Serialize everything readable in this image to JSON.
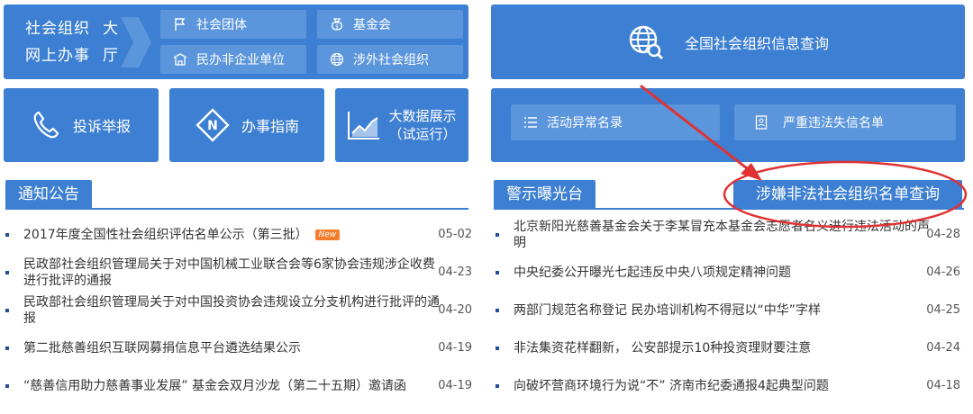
{
  "service_hall": {
    "title_line1": "社会组织",
    "title_line1_b": "大",
    "title_line2": "网上办事",
    "title_line2_b": "厅",
    "buttons": [
      {
        "label": "社会团体",
        "icon": "flag-icon"
      },
      {
        "label": "基金会",
        "icon": "money-bag-icon"
      },
      {
        "label": "民办非企业单位",
        "icon": "building-icon"
      },
      {
        "label": "涉外社会组织",
        "icon": "globe-icon"
      }
    ]
  },
  "info_query": {
    "label": "全国社会组织信息查询",
    "icon": "globe-search-icon"
  },
  "tiles": [
    {
      "label": "投诉举报",
      "icon": "phone-icon"
    },
    {
      "label": "办事指南",
      "icon": "compass-icon"
    },
    {
      "label_line1": "大数据展示",
      "label_line2": "（试运行）",
      "icon": "chart-icon"
    }
  ],
  "lists_box": {
    "abnormal": {
      "label": "活动异常名录",
      "icon": "list-icon"
    },
    "dishonest": {
      "label": "严重违法失信名单",
      "icon": "document-icon"
    }
  },
  "notice": {
    "tab_label": "通知公告",
    "items": [
      {
        "title": "2017年度全国性社会组织评估名单公示（第三批）",
        "badge": "New",
        "date": "05-02"
      },
      {
        "title": "民政部社会组织管理局关于对中国机械工业联合会等6家协会违规涉企收费进行批评的通报",
        "date": "04-23"
      },
      {
        "title": "民政部社会组织管理局关于对中国投资协会违规设立分支机构进行批评的通报",
        "date": "04-20"
      },
      {
        "title": "第二批慈善组织互联网募捐信息平台遴选结果公示",
        "date": "04-19"
      },
      {
        "title": "“慈善信用助力慈善事业发展” 基金会双月沙龙（第二十五期）邀请函",
        "date": "04-19"
      }
    ]
  },
  "warning": {
    "tab_label": "警示曝光台",
    "illegal_query_label": "涉嫌非法社会组织名单查询",
    "items": [
      {
        "title": "北京新阳光慈善基金会关于李某冒充本基金会志愿者名义进行违法活动的声明",
        "date": "04-28"
      },
      {
        "title": "中央纪委公开曝光七起违反中央八项规定精神问题",
        "date": "04-26"
      },
      {
        "title": "两部门规范名称登记 民办培训机构不得冠以“中华”字样",
        "date": "04-25"
      },
      {
        "title": "非法集资花样翻新， 公安部提示10种投资理财要注意",
        "date": "04-24"
      },
      {
        "title": "向破坏营商环境行为说“不” 济南市纪委通报4起典型问题",
        "date": "04-18"
      }
    ]
  },
  "colors": {
    "primary": "#3d7fd2",
    "button": "#5b95dc",
    "annotation": "#e03232",
    "badge": "#f37e2e"
  }
}
